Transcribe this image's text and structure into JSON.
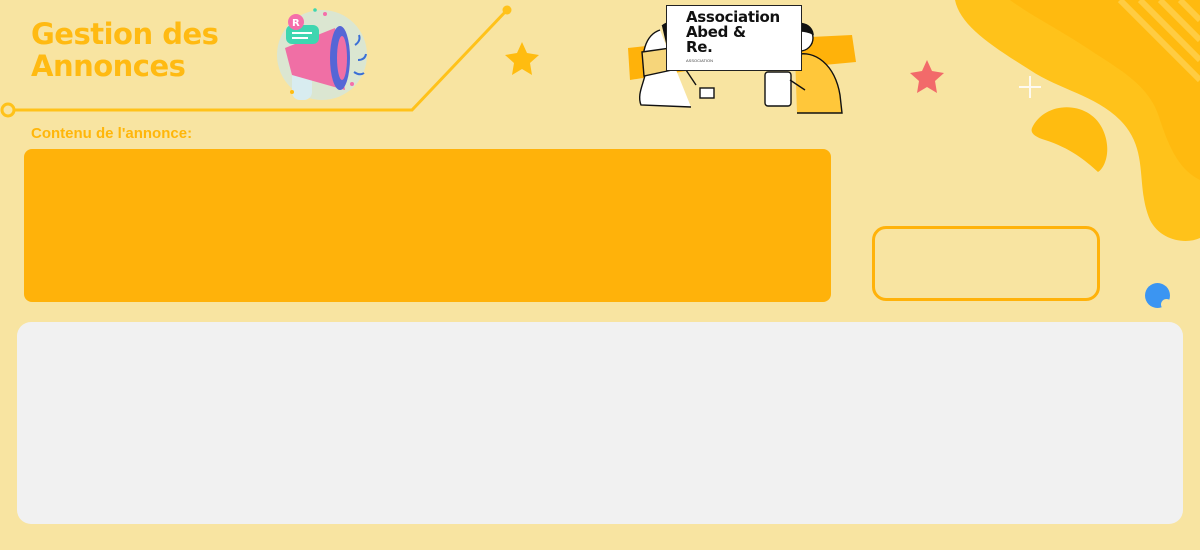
{
  "header": {
    "title": "Gestion des Annonces"
  },
  "logo": {
    "name": "Association\nAbed &\nRe.",
    "tagline": "ASSOCIATION"
  },
  "form": {
    "content_label": "Contenu de l'annonce:",
    "content_value": "",
    "submit_label": ""
  },
  "colors": {
    "background": "#f8e4a1",
    "accent": "#ffb20a",
    "panel": "#f1f1f1",
    "chat": "#3b95f2"
  },
  "icons": [
    "megaphone-icon",
    "star-icon",
    "chat-bubble-icon",
    "sparkle-icon"
  ]
}
